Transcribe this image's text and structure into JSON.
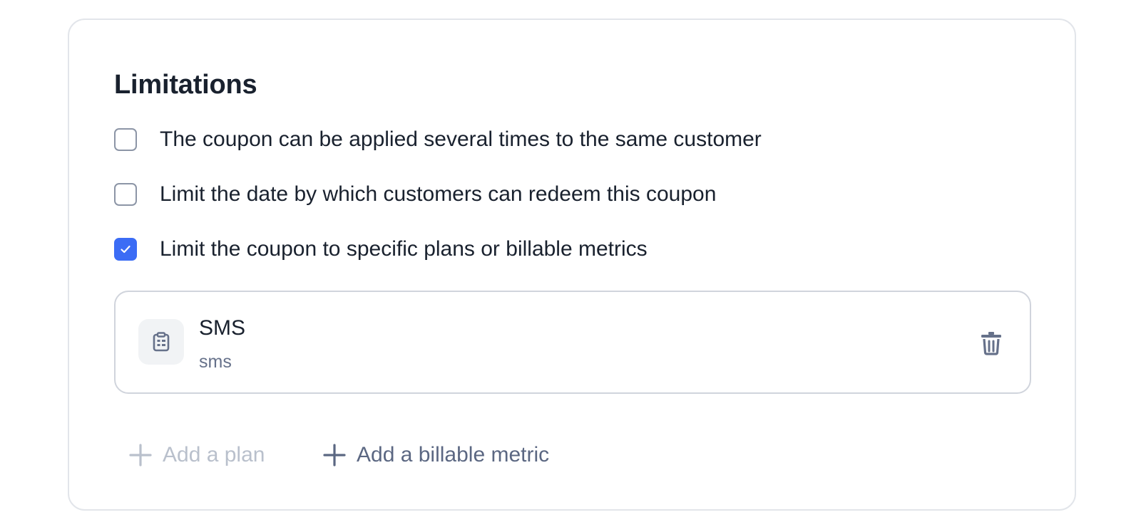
{
  "section": {
    "title": "Limitations"
  },
  "options": [
    {
      "label": "The coupon can be applied several times to the same customer",
      "checked": false
    },
    {
      "label": "Limit the date by which customers can redeem this coupon",
      "checked": false
    },
    {
      "label": "Limit the coupon to specific plans or billable metrics",
      "checked": true
    }
  ],
  "selected_item": {
    "name": "SMS",
    "code": "sms",
    "icon": "clipboard-icon",
    "delete_icon": "trash-icon"
  },
  "actions": {
    "add_plan_label": "Add a plan",
    "add_plan_disabled": true,
    "add_metric_label": "Add a billable metric"
  },
  "colors": {
    "accent": "#3b6cf5",
    "text": "#19212e",
    "muted": "#66718a",
    "disabled": "#b9c0cc",
    "border": "#e2e5ea"
  }
}
